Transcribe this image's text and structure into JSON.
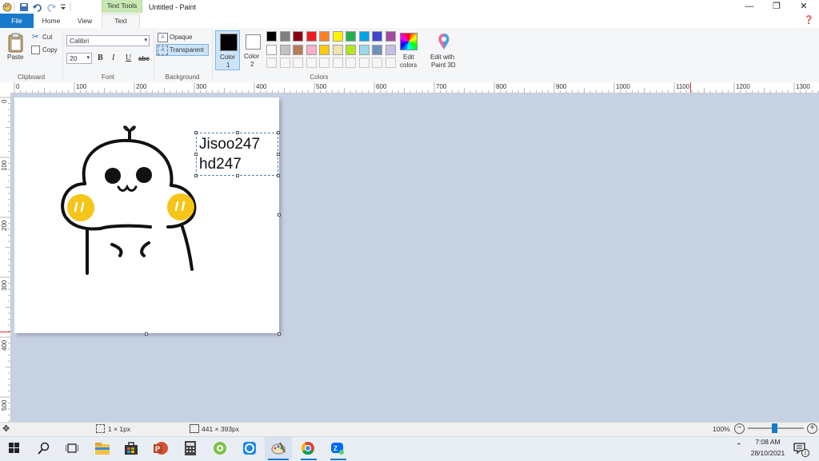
{
  "title_bar": {
    "window_title": "Untitled - Paint",
    "context_tab": "Text Tools"
  },
  "tabs": [
    "File",
    "Home",
    "View",
    "Text"
  ],
  "ribbon": {
    "clipboard": {
      "paste": "Paste",
      "cut": "Cut",
      "copy": "Copy",
      "group": "Clipboard"
    },
    "font": {
      "family": "Calibri",
      "size": "20",
      "bold": "B",
      "italic": "I",
      "underline": "U",
      "strike": "abc",
      "group": "Font"
    },
    "background": {
      "opaque": "Opaque",
      "transparent": "Transparent",
      "group": "Background"
    },
    "colors": {
      "color1_line1": "Color",
      "color1_line2": "1",
      "color2_line1": "Color",
      "color2_line2": "2",
      "group": "Colors",
      "edit_line1": "Edit",
      "edit_line2": "colors",
      "paint3d_line1": "Edit with",
      "paint3d_line2": "Paint 3D",
      "color1": "#000000",
      "color2": "#ffffff",
      "palette_row1": [
        "#000000",
        "#7f7f7f",
        "#880015",
        "#ed1c24",
        "#ff7f27",
        "#fff200",
        "#22b14c",
        "#00a2e8",
        "#3f48cc",
        "#a349a4"
      ],
      "palette_row2": [
        "#ffffff",
        "#c3c3c3",
        "#b97a57",
        "#ffaec9",
        "#ffc90e",
        "#efe4b0",
        "#b5e61d",
        "#99d9ea",
        "#7092be",
        "#c8bfe7"
      ]
    }
  },
  "ruler": {
    "h_ticks": [
      "0",
      "100",
      "200",
      "300",
      "400",
      "500",
      "600",
      "700",
      "800",
      "900",
      "1000",
      "1100",
      "1200",
      "1300"
    ],
    "v_ticks": [
      "0",
      "100",
      "200",
      "300",
      "400",
      "500"
    ]
  },
  "canvas": {
    "text_line1": "Jisoo247",
    "text_line2": "hd247"
  },
  "status": {
    "cursor": "1 × 1px",
    "size": "441 × 393px",
    "zoom": "100%"
  },
  "taskbar": {
    "time": "7:08 AM",
    "date": "28/10/2021",
    "notification_count": "1"
  }
}
